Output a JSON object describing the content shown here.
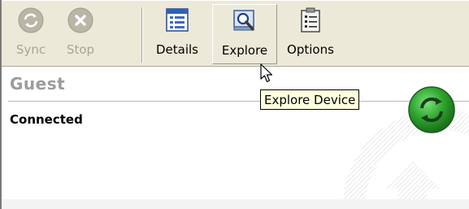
{
  "toolbar": {
    "buttons": [
      {
        "label": "Sync",
        "icon": "sync-icon",
        "enabled": false
      },
      {
        "label": "Stop",
        "icon": "stop-icon",
        "enabled": false
      },
      {
        "label": "Details",
        "icon": "details-icon",
        "enabled": true
      },
      {
        "label": "Explore",
        "icon": "explore-icon",
        "enabled": true,
        "hovered": true
      },
      {
        "label": "Options",
        "icon": "options-icon",
        "enabled": true
      }
    ]
  },
  "device": {
    "name": "Guest",
    "status": "Connected",
    "status_icon": "sync-status-icon",
    "status_color": "#2e9e2e"
  },
  "tooltip": {
    "text": "Explore Device"
  },
  "colors": {
    "toolbar_bg": "#ece9d8",
    "tooltip_bg": "#ffffe1",
    "disabled_text": "#a7a596",
    "profile_name": "#9c9c9c"
  }
}
